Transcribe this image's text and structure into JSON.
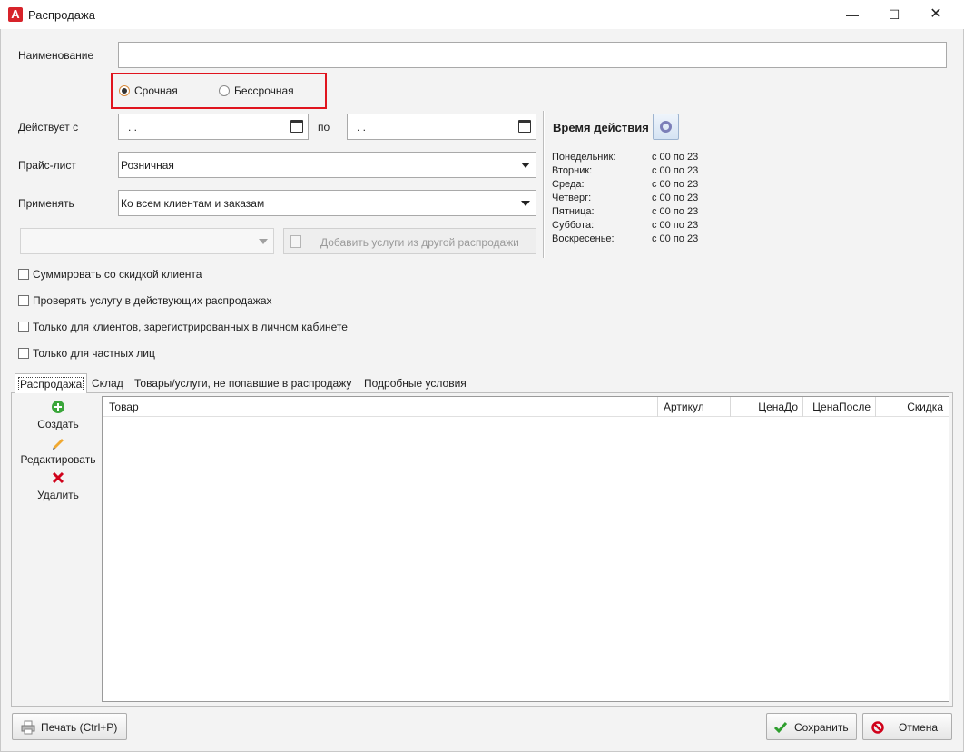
{
  "window": {
    "title": "Распродажа",
    "app_icon_letter": "A",
    "minimize": "—",
    "maximize": "☐",
    "close": "✕"
  },
  "form": {
    "name_label": "Наименование",
    "name_value": "",
    "type_options": [
      {
        "label": "Срочная",
        "selected": true
      },
      {
        "label": "Бессрочная",
        "selected": false
      }
    ],
    "valid_from_label": "Действует с",
    "valid_from_value": ". .",
    "valid_to_label": "по",
    "valid_to_value": ". .",
    "pricelist_label": "Прайс-лист",
    "pricelist_value": "Розничная",
    "apply_label": "Применять",
    "apply_value": "Ко всем клиентам и заказам",
    "sale_combo_value": "",
    "add_services_button": "Добавить услуги из другой распродажи",
    "checkboxes": [
      {
        "label": "Суммировать со скидкой клиента",
        "checked": false
      },
      {
        "label": "Проверять услугу в действующих распродажах",
        "checked": false
      },
      {
        "label": "Только для клиентов, зарегистрированных в личном кабинете",
        "checked": false
      },
      {
        "label": "Только для частных лиц",
        "checked": false
      }
    ]
  },
  "schedule": {
    "title": "Время действия",
    "days": [
      {
        "day": "Понедельник:",
        "time": "с 00 по 23"
      },
      {
        "day": "Вторник:",
        "time": "с 00 по 23"
      },
      {
        "day": "Среда:",
        "time": "с 00 по 23"
      },
      {
        "day": "Четверг:",
        "time": "с 00 по 23"
      },
      {
        "day": "Пятница:",
        "time": "с 00 по 23"
      },
      {
        "day": "Суббота:",
        "time": "с 00 по 23"
      },
      {
        "day": "Воскресенье:",
        "time": "с 00 по 23"
      }
    ]
  },
  "tabs": [
    {
      "label": "Распродажа",
      "active": true
    },
    {
      "label": "Склад",
      "active": false
    },
    {
      "label": "Товары/услуги, не попавшие в распродажу",
      "active": false
    },
    {
      "label": "Подробные условия",
      "active": false
    }
  ],
  "side_actions": {
    "create": "Создать",
    "edit": "Редактировать",
    "delete": "Удалить"
  },
  "grid": {
    "columns": [
      "Товар",
      "Артикул",
      "ЦенаДо",
      "ЦенаПосле",
      "Скидка"
    ],
    "rows": []
  },
  "footer": {
    "print": "Печать (Ctrl+P)",
    "save": "Сохранить",
    "cancel": "Отмена"
  },
  "colors": {
    "highlight_box": "#e0141e",
    "save_check": "#2e9e2e",
    "cancel_icon": "#d0021b",
    "create_icon": "#3aa63a",
    "delete_icon": "#d0021b"
  }
}
